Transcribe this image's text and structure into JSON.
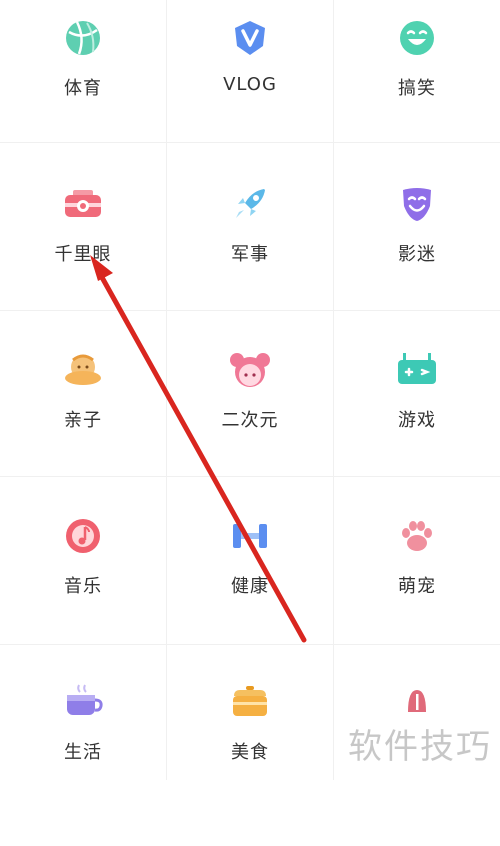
{
  "categories": [
    {
      "label": "体育",
      "icon": "basketball-icon",
      "color": "#5ecfb1"
    },
    {
      "label": "VLOG",
      "icon": "v-shield-icon",
      "color": "#5b8ef0"
    },
    {
      "label": "搞笑",
      "icon": "laughing-face-icon",
      "color": "#4fd2b0"
    },
    {
      "label": "千里眼",
      "icon": "camera-icon",
      "color": "#f06a7a"
    },
    {
      "label": "军事",
      "icon": "rocket-icon",
      "color": "#5bb8e8"
    },
    {
      "label": "影迷",
      "icon": "mask-icon",
      "color": "#8f6ee8"
    },
    {
      "label": "亲子",
      "icon": "baby-icon",
      "color": "#f5b45a"
    },
    {
      "label": "二次元",
      "icon": "anime-girl-icon",
      "color": "#f07896"
    },
    {
      "label": "游戏",
      "icon": "gamepad-icon",
      "color": "#3dc9b5"
    },
    {
      "label": "音乐",
      "icon": "music-disc-icon",
      "color": "#f0606e"
    },
    {
      "label": "健康",
      "icon": "dumbbell-icon",
      "color": "#5b8ef0"
    },
    {
      "label": "萌宠",
      "icon": "paw-icon",
      "color": "#f0909e"
    },
    {
      "label": "生活",
      "icon": "cup-icon",
      "color": "#8f7ee8"
    },
    {
      "label": "美食",
      "icon": "rice-cooker-icon",
      "color": "#f5b042"
    },
    {
      "label": "",
      "icon": "partial-icon",
      "color": "#e06a7a"
    }
  ],
  "annotation": {
    "arrow_color": "#d9261f"
  },
  "watermark": "软件技巧"
}
